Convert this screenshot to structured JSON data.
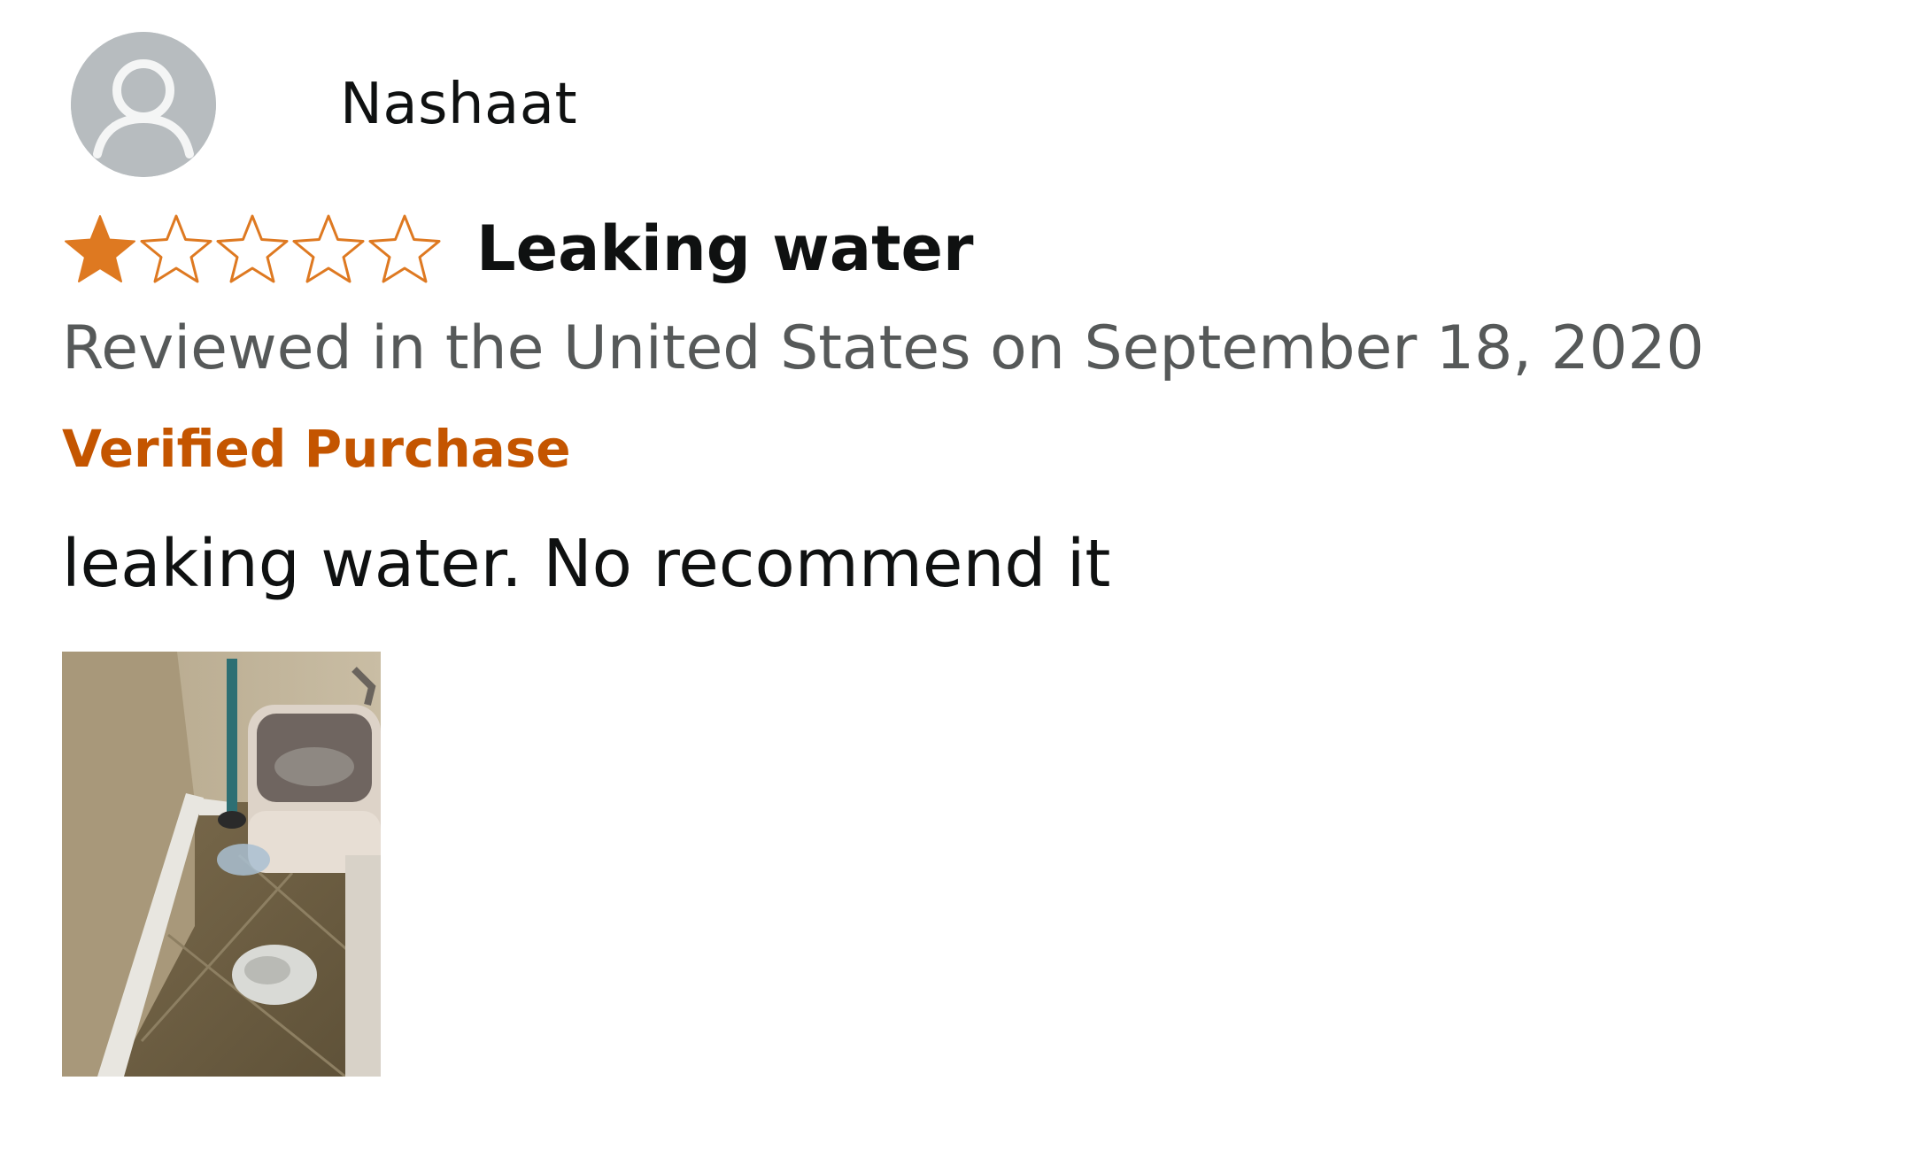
{
  "review": {
    "author": {
      "name": "Nashaat",
      "avatar_icon": "default-user-icon"
    },
    "rating": {
      "value": 1,
      "max": 5,
      "filled_color": "#de7921",
      "empty_color": "#de7921"
    },
    "title": "Leaking water",
    "date_line": "Reviewed in the United States on September 18, 2020",
    "badge": "Verified Purchase",
    "badge_color": "#c45500",
    "body": "leaking water. No recommend it",
    "images": [
      {
        "subject": "bathroom-floor-toilet-leak-photo"
      }
    ]
  }
}
